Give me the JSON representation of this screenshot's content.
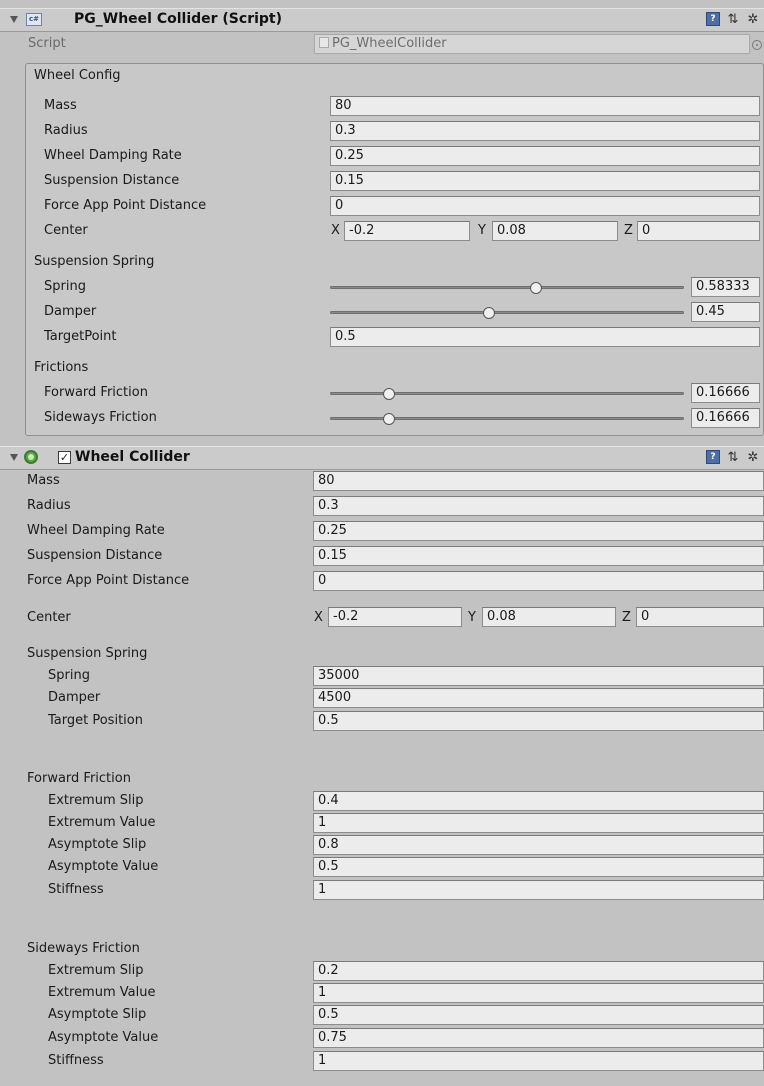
{
  "pg": {
    "title": "PG_Wheel Collider (Script)",
    "script_label": "Script",
    "script_value": "PG_WheelCollider",
    "wheel_config": {
      "heading": "Wheel Config",
      "rows": [
        {
          "label": "Mass",
          "value": "80"
        },
        {
          "label": "Radius",
          "value": "0.3"
        },
        {
          "label": "Wheel Damping Rate",
          "value": "0.25"
        },
        {
          "label": "Suspension Distance",
          "value": "0.15"
        },
        {
          "label": "Force App Point Distance",
          "value": "0"
        }
      ],
      "center": {
        "label": "Center",
        "x": "-0.2",
        "y": "0.08",
        "z": "0"
      }
    },
    "suspension": {
      "heading": "Suspension Spring",
      "spring": {
        "label": "Spring",
        "value": "0.58333",
        "fraction": 0.58333
      },
      "damper": {
        "label": "Damper",
        "value": "0.45",
        "fraction": 0.45
      },
      "target": {
        "label": "TargetPoint",
        "value": "0.5"
      }
    },
    "frictions": {
      "heading": "Frictions",
      "forward": {
        "label": "Forward Friction",
        "value": "0.16666",
        "fraction": 0.16666
      },
      "sideways": {
        "label": "Sideways Friction",
        "value": "0.16666",
        "fraction": 0.16666
      }
    }
  },
  "wc": {
    "title": "Wheel Collider",
    "checked": true,
    "rows": [
      {
        "label": "Mass",
        "value": "80"
      },
      {
        "label": "Radius",
        "value": "0.3"
      },
      {
        "label": "Wheel Damping Rate",
        "value": "0.25"
      },
      {
        "label": "Suspension Distance",
        "value": "0.15"
      },
      {
        "label": "Force App Point Distance",
        "value": "0"
      }
    ],
    "center": {
      "label": "Center",
      "x": "-0.2",
      "y": "0.08",
      "z": "0"
    },
    "suspension": {
      "heading": "Suspension Spring",
      "rows": [
        {
          "label": "Spring",
          "value": "35000"
        },
        {
          "label": "Damper",
          "value": "4500"
        },
        {
          "label": "Target Position",
          "value": "0.5"
        }
      ]
    },
    "forward": {
      "heading": "Forward Friction",
      "rows": [
        {
          "label": "Extremum Slip",
          "value": "0.4"
        },
        {
          "label": "Extremum Value",
          "value": "1"
        },
        {
          "label": "Asymptote Slip",
          "value": "0.8"
        },
        {
          "label": "Asymptote Value",
          "value": "0.5"
        },
        {
          "label": "Stiffness",
          "value": "1"
        }
      ]
    },
    "sideways": {
      "heading": "Sideways Friction",
      "rows": [
        {
          "label": "Extremum Slip",
          "value": "0.2"
        },
        {
          "label": "Extremum Value",
          "value": "1"
        },
        {
          "label": "Asymptote Slip",
          "value": "0.5"
        },
        {
          "label": "Asymptote Value",
          "value": "0.75"
        },
        {
          "label": "Stiffness",
          "value": "1"
        }
      ]
    }
  },
  "axis_labels": {
    "x": "X",
    "y": "Y",
    "z": "Z"
  },
  "icons": {
    "help": "help-book-icon",
    "preset": "preset-icon",
    "settings": "gear-icon"
  }
}
